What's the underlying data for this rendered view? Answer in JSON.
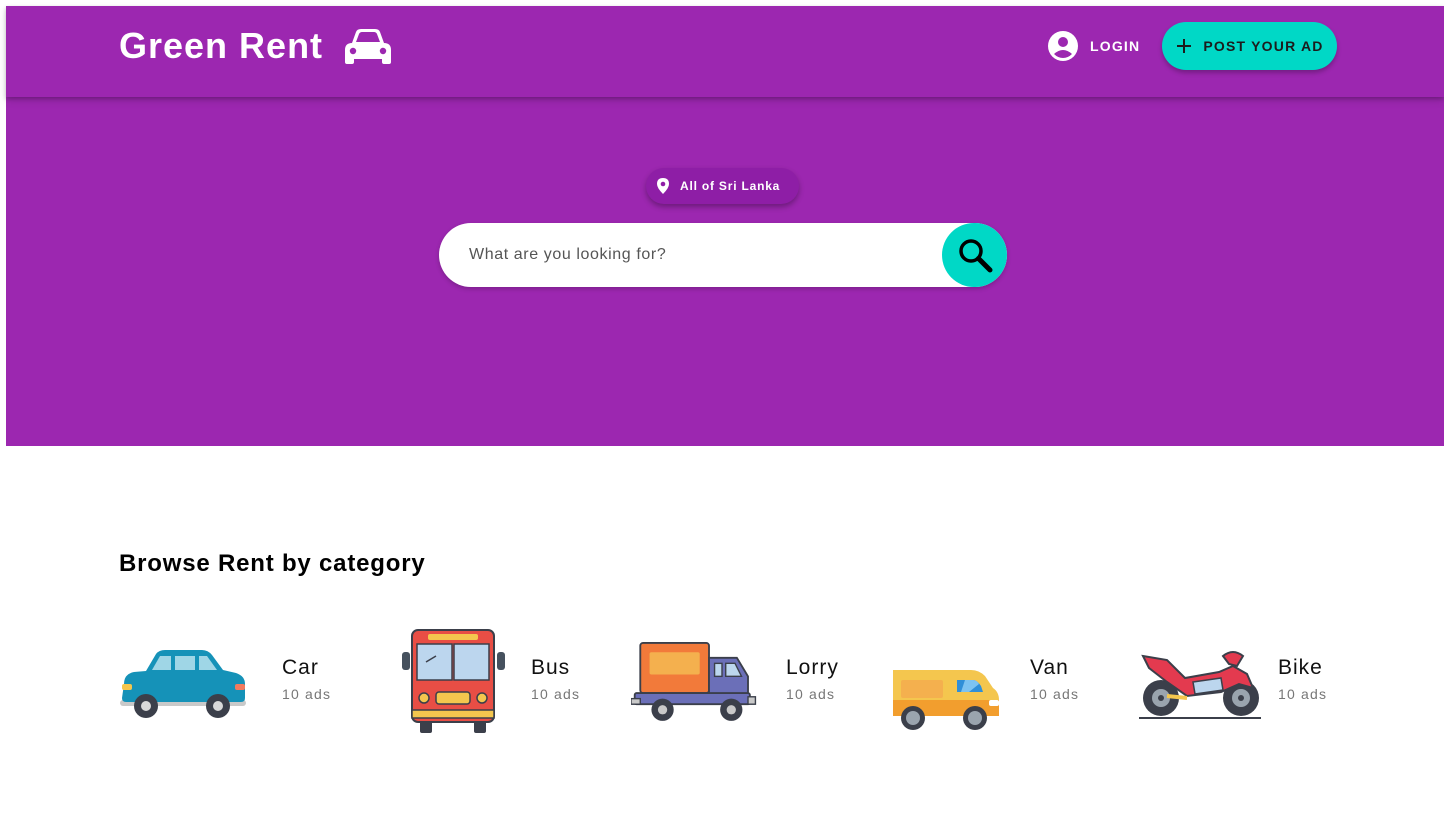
{
  "header": {
    "brand_title": "Green Rent",
    "brand_icon": "car-icon",
    "login_label": "LOGIN",
    "login_icon": "account-circle-icon",
    "post_ad_label": "POST YOUR AD",
    "post_ad_icon": "plus-icon"
  },
  "hero": {
    "location_label": "All of Sri Lanka",
    "location_icon": "location-pin-icon",
    "search_placeholder": "What are you looking for?",
    "search_icon": "search-icon"
  },
  "categories_section": {
    "title": "Browse Rent by category",
    "items": [
      {
        "name": "Car",
        "count": "10 ads",
        "icon": "car-illustration-icon"
      },
      {
        "name": "Bus",
        "count": "10 ads",
        "icon": "bus-illustration-icon"
      },
      {
        "name": "Lorry",
        "count": "10 ads",
        "icon": "lorry-illustration-icon"
      },
      {
        "name": "Van",
        "count": "10 ads",
        "icon": "van-illustration-icon"
      },
      {
        "name": "Bike",
        "count": "10 ads",
        "icon": "motorbike-illustration-icon"
      }
    ]
  },
  "colors": {
    "primary_purple": "#9c27b0",
    "chip_purple": "#8e1ea6",
    "accent_teal": "#00d8c6",
    "white": "#ffffff"
  }
}
